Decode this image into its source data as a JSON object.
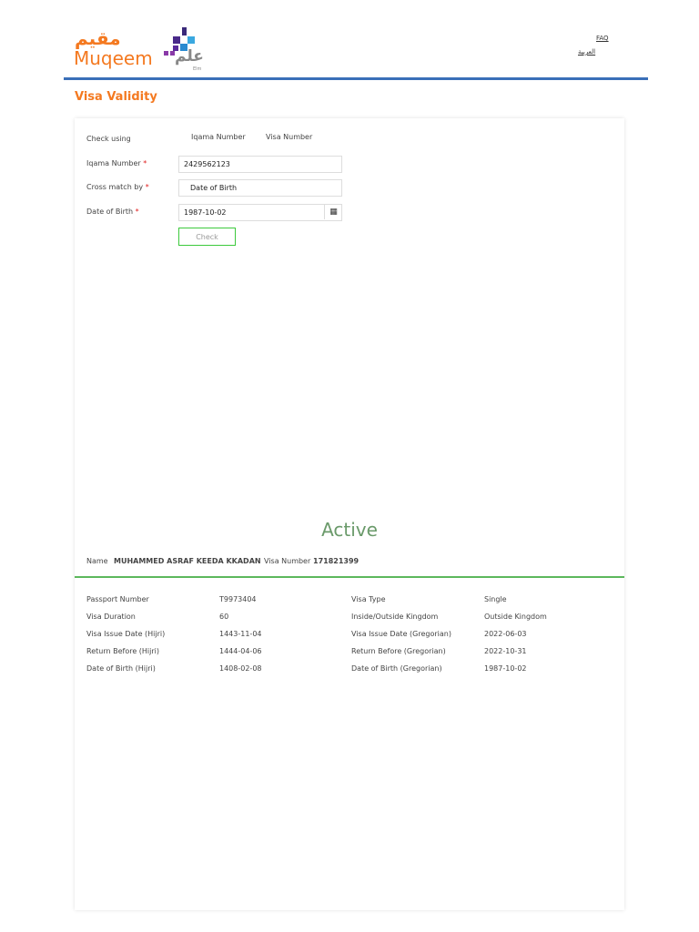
{
  "header": {
    "logo_ar": "مقيم",
    "logo_en": "Muqeem",
    "elm_ar": "علم",
    "elm_en": "Elm",
    "faq": "FAQ",
    "arabic": "العربية"
  },
  "page_title": "Visa Validity",
  "form": {
    "check_using_label": "Check using",
    "option_iqama": "Iqama Number",
    "option_visa": "Visa Number",
    "iqama_label": "Iqama Number",
    "iqama_value": "2429562123",
    "cross_label": "Cross match by",
    "cross_value": "Date of Birth",
    "dob_label": "Date of Birth",
    "dob_value": "1987-10-02",
    "required": "*",
    "check_button": "Check"
  },
  "result": {
    "status": "Active",
    "name_label": "Name",
    "name": "MUHAMMED ASRAF KEEDA KKADAN",
    "visa_number_label": "Visa Number",
    "visa_number": "171821399",
    "rows": [
      {
        "l1": "Passport Number",
        "v1": "T9973404",
        "l2": "Visa Type",
        "v2": "Single"
      },
      {
        "l1": "Visa Duration",
        "v1": "60",
        "l2": "Inside/Outside Kingdom",
        "v2": "Outside Kingdom"
      },
      {
        "l1": "Visa Issue Date (Hijri)",
        "v1": "1443-11-04",
        "l2": "Visa Issue Date (Gregorian)",
        "v2": "2022-06-03"
      },
      {
        "l1": "Return Before (Hijri)",
        "v1": "1444-04-06",
        "l2": "Return Before (Gregorian)",
        "v2": "2022-10-31"
      },
      {
        "l1": "Date of Birth (Hijri)",
        "v1": "1408-02-08",
        "l2": "Date of Birth (Gregorian)",
        "v2": "1987-10-02"
      }
    ]
  }
}
